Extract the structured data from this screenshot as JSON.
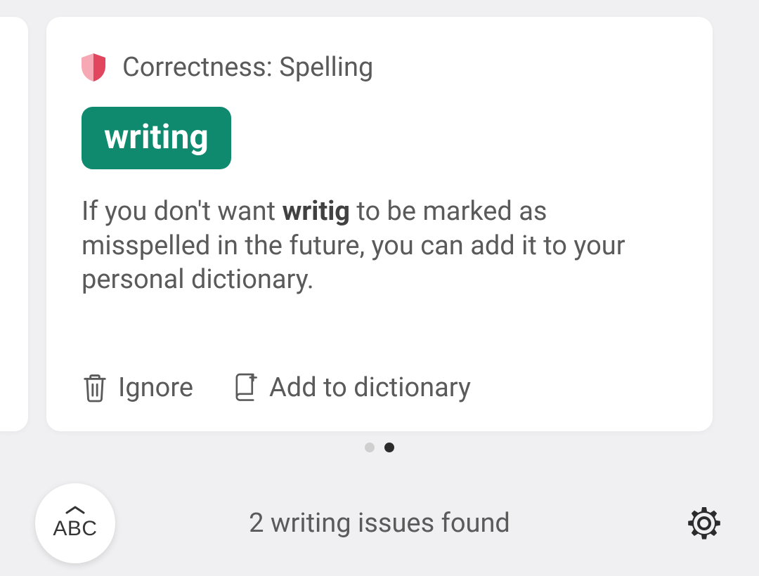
{
  "card": {
    "category_label": "Correctness: Spelling",
    "correction": "writing",
    "description_prefix": "If you don't want ",
    "description_bold": "writig",
    "description_suffix": " to be marked as misspelled in the future, you can add it to your personal dictionary.",
    "actions": {
      "ignore": "Ignore",
      "add_to_dictionary": "Add to dictionary"
    }
  },
  "pager": {
    "total": 2,
    "active_index": 1
  },
  "bottom_bar": {
    "keyboard_label": "ABC",
    "status": "2 writing issues found"
  },
  "colors": {
    "accent_green": "#0f8a6e",
    "shield_red": "#e2465f",
    "shield_pink": "#f6a9b4",
    "text_muted": "#5a5a5a"
  }
}
